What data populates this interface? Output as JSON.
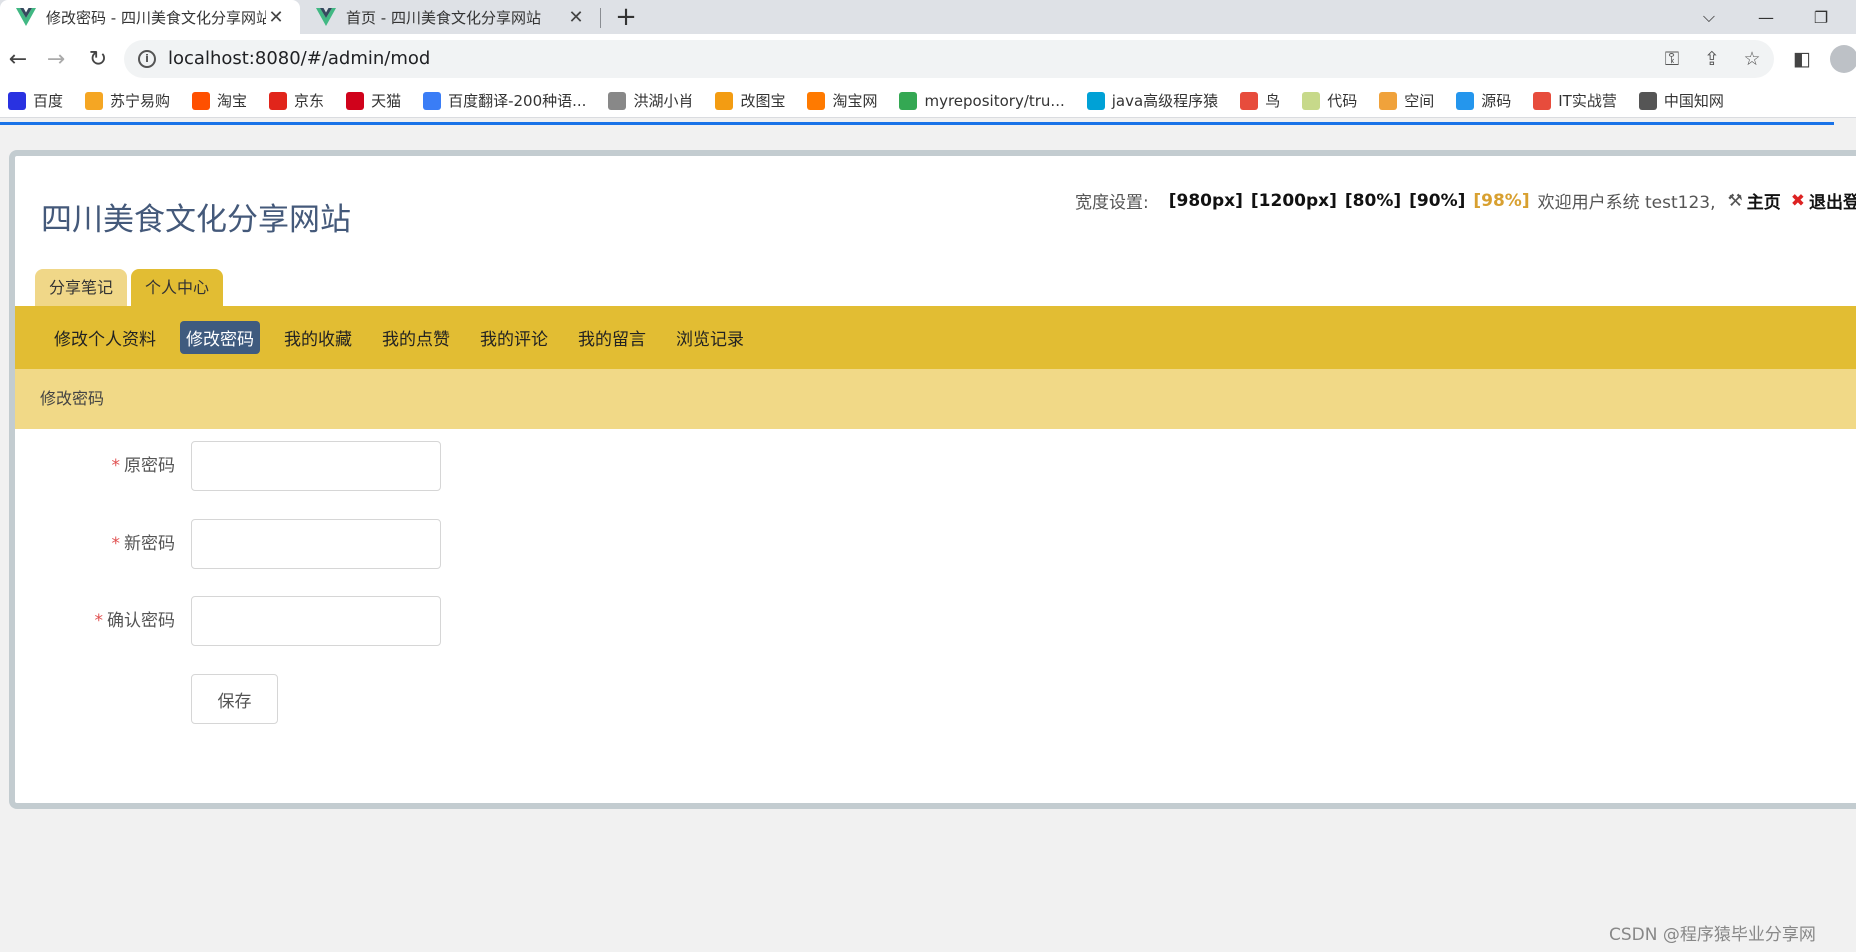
{
  "browser": {
    "tabs": [
      {
        "title": "修改密码 - 四川美食文化分享网站",
        "active": true
      },
      {
        "title": "首页 - 四川美食文化分享网站",
        "active": false
      }
    ],
    "close_glyph": "✕",
    "url": "localhost:8080/#/admin/mod",
    "bookmarks": [
      {
        "label": "百度",
        "icon": "baidu-icon",
        "color": "#2932e1"
      },
      {
        "label": "苏宁易购",
        "icon": "suning-icon",
        "color": "#f5a623"
      },
      {
        "label": "淘宝",
        "icon": "taobao-icon",
        "color": "#ff5000"
      },
      {
        "label": "京东",
        "icon": "jd-icon",
        "color": "#e1251b"
      },
      {
        "label": "天猫",
        "icon": "tmall-icon",
        "color": "#d0021b"
      },
      {
        "label": "百度翻译-200种语...",
        "icon": "baidu-translate-icon",
        "color": "#3a7df6"
      },
      {
        "label": "洪湖小肖",
        "icon": "bird-icon",
        "color": "#888888"
      },
      {
        "label": "改图宝",
        "icon": "gaitubao-icon",
        "color": "#f39c12"
      },
      {
        "label": "淘宝网",
        "icon": "taobao-icon",
        "color": "#ff7a00"
      },
      {
        "label": "myrepository/tru...",
        "icon": "chrome-icon",
        "color": "#34a853"
      },
      {
        "label": "java高级程序猿",
        "icon": "bilibili-icon",
        "color": "#00a1d6"
      },
      {
        "label": "鸟",
        "icon": "bird-red-icon",
        "color": "#e74c3c"
      },
      {
        "label": "代码",
        "icon": "code-icon",
        "color": "#c7d98a"
      },
      {
        "label": "空间",
        "icon": "qzone-icon",
        "color": "#f0a23b"
      },
      {
        "label": "源码",
        "icon": "docker-icon",
        "color": "#2496ed"
      },
      {
        "label": "IT实战营",
        "icon": "it-icon",
        "color": "#e74c3c"
      },
      {
        "label": "中国知网",
        "icon": "cnki-icon",
        "color": "#555555"
      }
    ]
  },
  "site": {
    "title": "四川美食文化分享网站",
    "width_label": "宽度设置:",
    "width_options": [
      "[980px]",
      "[1200px]",
      "[80%]",
      "[90%]",
      "[98%]"
    ],
    "width_selected": "[98%]",
    "welcome": "欢迎用户系统 test123,",
    "home_link": "主页",
    "logout_link": "退出登录",
    "accent": "#e2bd33",
    "main_tabs": [
      "分享笔记",
      "个人中心"
    ],
    "sub_nav": [
      "修改个人资料",
      "修改密码",
      "我的收藏",
      "我的点赞",
      "我的评论",
      "我的留言",
      "浏览记录"
    ],
    "sub_nav_active": "修改密码",
    "section_title": "修改密码"
  },
  "form": {
    "fields": [
      {
        "label": "原密码",
        "required": true,
        "value": ""
      },
      {
        "label": "新密码",
        "required": true,
        "value": ""
      },
      {
        "label": "确认密码",
        "required": true,
        "value": ""
      }
    ],
    "required_mark": "*",
    "save_label": "保存"
  },
  "watermark": "CSDN @程序猿毕业分享网"
}
